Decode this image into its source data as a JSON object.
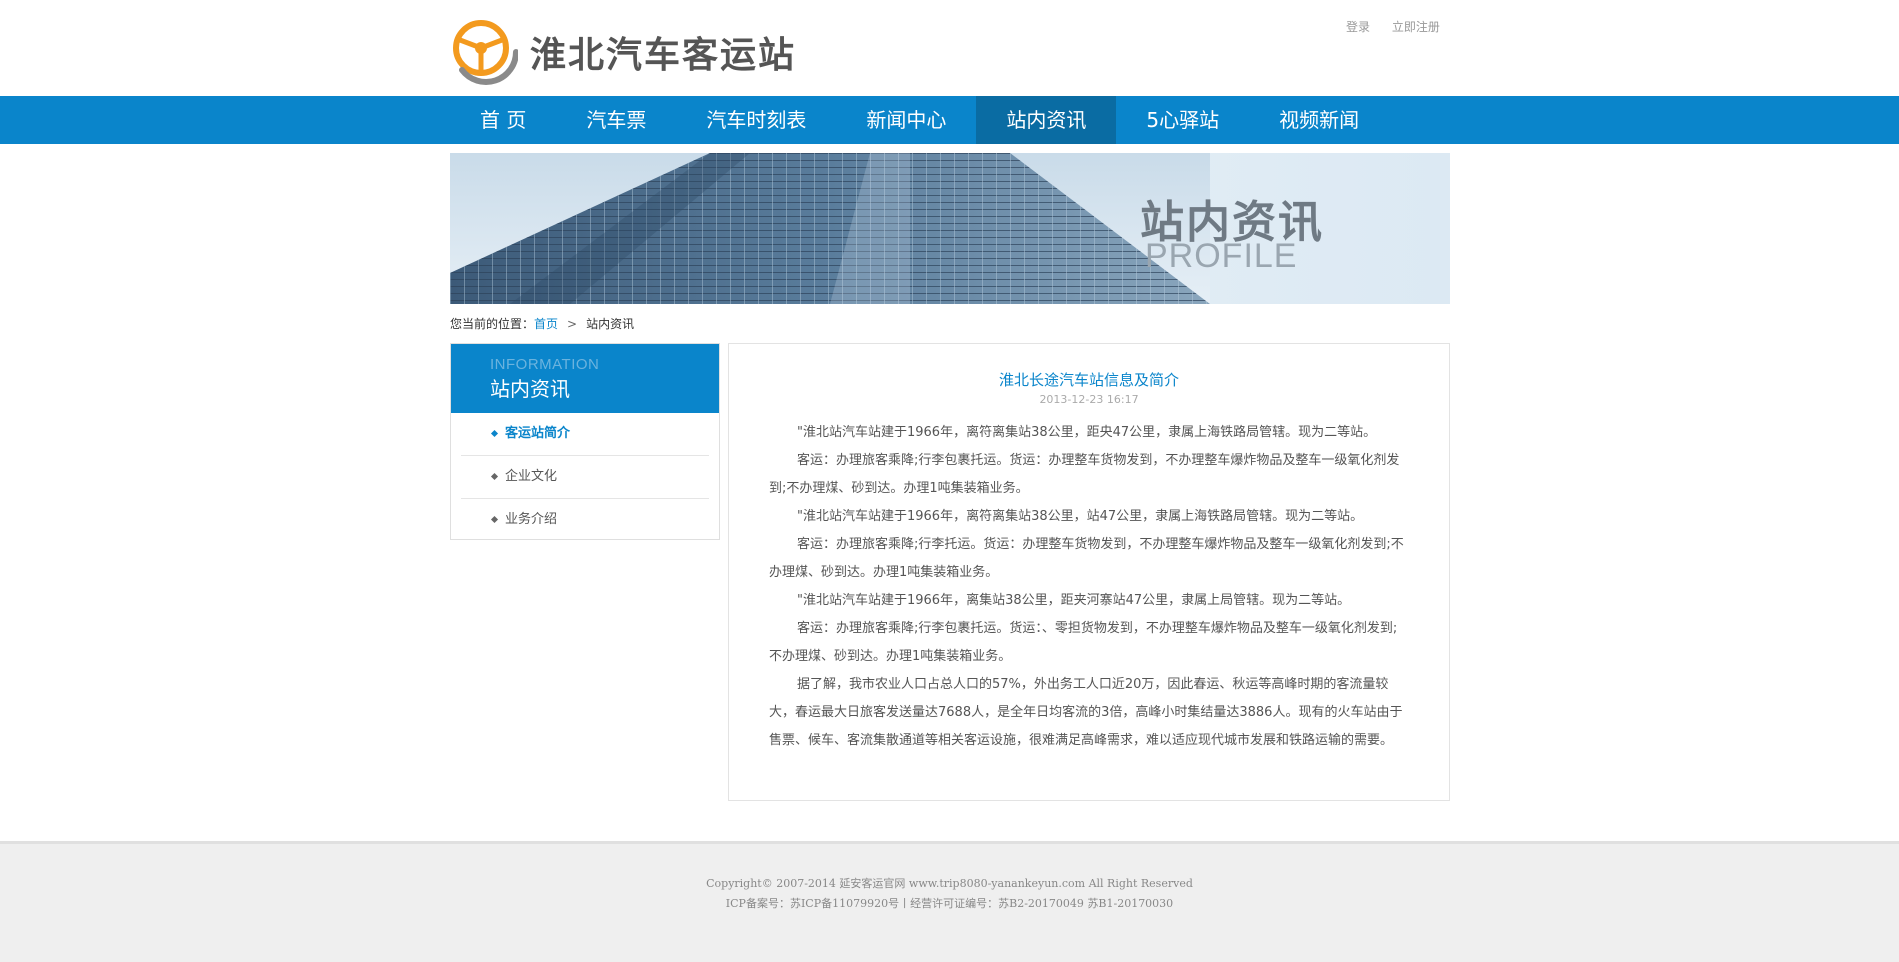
{
  "header": {
    "logo_text": "淮北汽车客运站",
    "login": "登录",
    "register": "立即注册"
  },
  "nav": {
    "items": [
      "首 页",
      "汽车票",
      "汽车时刻表",
      "新闻中心",
      "站内资讯",
      "5心驿站",
      "视频新闻"
    ],
    "active": "站内资讯"
  },
  "banner": {
    "title": "站内资讯",
    "subtitle": "PROFILE"
  },
  "breadcrumb": {
    "prefix": "您当前的位置：",
    "home": "首页",
    "separator": ">",
    "current": "站内资讯"
  },
  "sidebar": {
    "en_title": "INFORMATION",
    "cn_title": "站内资讯",
    "items": [
      "客运站简介",
      "企业文化",
      "业务介绍"
    ]
  },
  "article": {
    "title": "淮北长途汽车站信息及简介",
    "date": "2013-12-23 16:17",
    "paragraphs": [
      "\"淮北站汽车站建于1966年，离符离集站38公里，距央47公里，隶属上海铁路局管辖。现为二等站。",
      "客运：办理旅客乘降;行李包裹托运。货运：办理整车货物发到，不办理整车爆炸物品及整车一级氧化剂发到;不办理煤、砂到达。办理1吨集装箱业务。",
      "\"淮北站汽车站建于1966年，离符离集站38公里，站47公里，隶属上海铁路局管辖。现为二等站。",
      "客运：办理旅客乘降;行李托运。货运：办理整车货物发到，不办理整车爆炸物品及整车一级氧化剂发到;不办理煤、砂到达。办理1吨集装箱业务。",
      "\"淮北站汽车站建于1966年，离集站38公里，距夹河寨站47公里，隶属上局管辖。现为二等站。",
      "客运：办理旅客乘降;行李包裹托运。货运：、零担货物发到，不办理整车爆炸物品及整车一级氧化剂发到;不办理煤、砂到达。办理1吨集装箱业务。",
      "据了解，我市农业人口占总人口的57%，外出务工人口近20万，因此春运、秋运等高峰时期的客流量较大，春运最大日旅客发送量达7688人，是全年日均客流的3倍，高峰小时集结量达3886人。现有的火车站由于售票、候车、客流集散通道等相关客运设施，很难满足高峰需求，难以适应现代城市发展和铁路运输的需要。"
    ]
  },
  "footer": {
    "line1": "Copyright© 2007-2014 延安客运官网 www.trip8080-yanankeyun.com All Right Reserved",
    "line2": "ICP备案号：苏ICP备11079920号丨经营许可证编号：苏B2-20170049 苏B1-20170030"
  },
  "colors": {
    "brand_blue": "#0a85cb",
    "nav_active": "#0a6ca3",
    "logo_orange": "#f39a1e"
  }
}
